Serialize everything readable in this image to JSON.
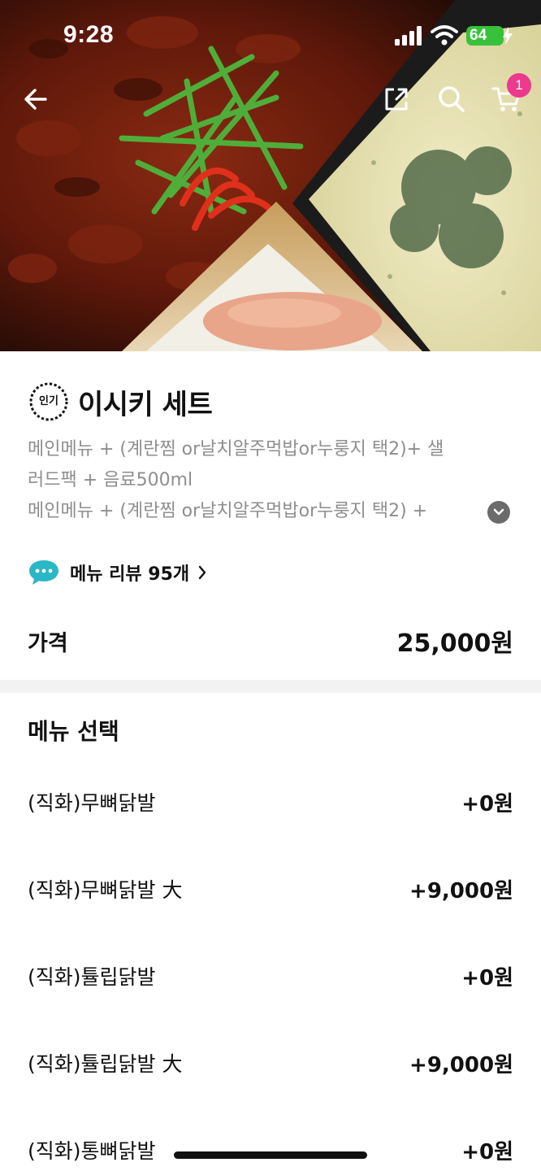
{
  "status_bar": {
    "time": "9:28",
    "battery": "64"
  },
  "nav": {
    "cart_count": "1"
  },
  "product": {
    "badge": "인기",
    "title": "이시키 세트",
    "description_lines": [
      "메인메뉴 + (계란찜 or날치알주먹밥or누룽지 택2)+ 샐",
      "러드팩  + 음료500ml",
      "메인메뉴 +  (계란찜 or날치알주먹밥or누룽지 택2) +"
    ],
    "review_label": "메뉴 리뷰 95개",
    "price_label": "가격",
    "price_value": "25,000원"
  },
  "menu_select": {
    "title": "메뉴 선택",
    "options": [
      {
        "name": "(직화)무뼈닭발",
        "price": "+0원"
      },
      {
        "name": "(직화)무뼈닭발 大",
        "price": "+9,000원"
      },
      {
        "name": "(직화)튤립닭발",
        "price": "+0원"
      },
      {
        "name": "(직화)튤립닭발 大",
        "price": "+9,000원"
      },
      {
        "name": "(직화)통뼈닭발",
        "price": "+0원"
      }
    ]
  },
  "colors": {
    "badge_pink": "#ec3a8c",
    "battery_green": "#38c13a",
    "review_icon_teal": "#2ab7c6",
    "muted_text": "#8e8e8e"
  },
  "icons": [
    "back-arrow-icon",
    "share-icon",
    "search-icon",
    "cart-icon",
    "chat-bubble-icon",
    "chevron-right-icon",
    "chevron-down-icon"
  ]
}
